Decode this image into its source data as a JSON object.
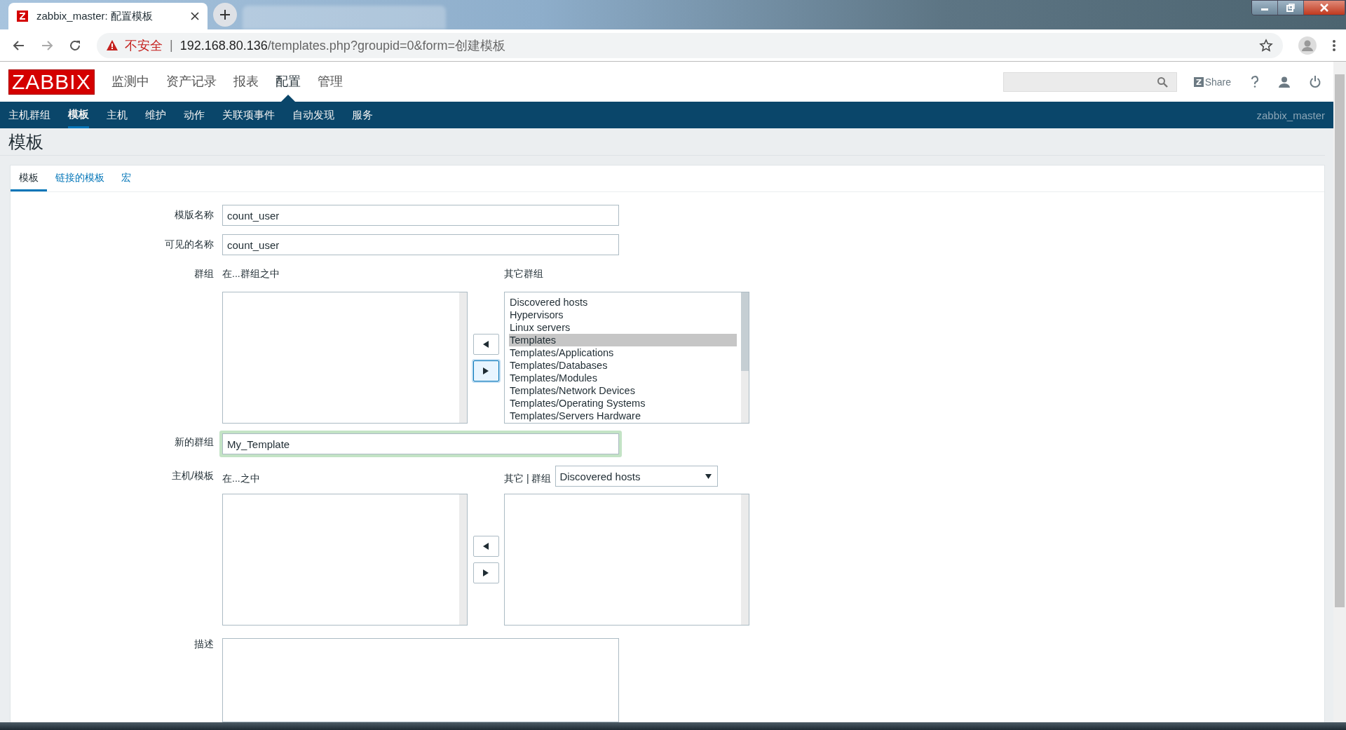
{
  "browser": {
    "tab_title": "zabbix_master: 配置模板",
    "security": "不安全",
    "separator": "|",
    "url_host": "192.168.80.136",
    "url_path": "/templates.php?groupid=0&form=创建模板"
  },
  "header": {
    "logo": "ZABBIX",
    "menu": [
      {
        "label": "监测中",
        "selected": false
      },
      {
        "label": "资产记录",
        "selected": false
      },
      {
        "label": "报表",
        "selected": false
      },
      {
        "label": "配置",
        "selected": true
      },
      {
        "label": "管理",
        "selected": false
      }
    ],
    "share": "Share"
  },
  "subnav": {
    "items": [
      {
        "label": "主机群组",
        "selected": false
      },
      {
        "label": "模板",
        "selected": true
      },
      {
        "label": "主机",
        "selected": false
      },
      {
        "label": "维护",
        "selected": false
      },
      {
        "label": "动作",
        "selected": false
      },
      {
        "label": "关联项事件",
        "selected": false
      },
      {
        "label": "自动发现",
        "selected": false
      },
      {
        "label": "服务",
        "selected": false
      }
    ],
    "user": "zabbix_master"
  },
  "page_title": "模板",
  "tabs": [
    {
      "label": "模板",
      "selected": true
    },
    {
      "label": "链接的模板",
      "selected": false
    },
    {
      "label": "宏",
      "selected": false
    }
  ],
  "form": {
    "template_name": {
      "label": "模版名称",
      "value": "count_user"
    },
    "visible_name": {
      "label": "可见的名称",
      "value": "count_user"
    },
    "groups": {
      "label": "群组",
      "in_label": "在...群组之中",
      "other_label": "其它群组",
      "other": [
        {
          "name": "Discovered hosts",
          "selected": false
        },
        {
          "name": "Hypervisors",
          "selected": false
        },
        {
          "name": "Linux servers",
          "selected": false
        },
        {
          "name": "Templates",
          "selected": true
        },
        {
          "name": "Templates/Applications",
          "selected": false
        },
        {
          "name": "Templates/Databases",
          "selected": false
        },
        {
          "name": "Templates/Modules",
          "selected": false
        },
        {
          "name": "Templates/Network Devices",
          "selected": false
        },
        {
          "name": "Templates/Operating Systems",
          "selected": false
        },
        {
          "name": "Templates/Servers Hardware",
          "selected": false
        }
      ],
      "buttons": [
        {
          "kind": "left",
          "focused": false
        },
        {
          "kind": "right",
          "focused": true
        }
      ]
    },
    "new_group": {
      "label": "新的群组",
      "value": "My_Template"
    },
    "hosts": {
      "label": "主机/模板",
      "in_label": "在...之中",
      "other_label": "其它 | 群组",
      "group_select": "Discovered hosts",
      "buttons": [
        {
          "kind": "left",
          "focused": false
        },
        {
          "kind": "right",
          "focused": false
        }
      ]
    },
    "description": {
      "label": "描述"
    }
  }
}
